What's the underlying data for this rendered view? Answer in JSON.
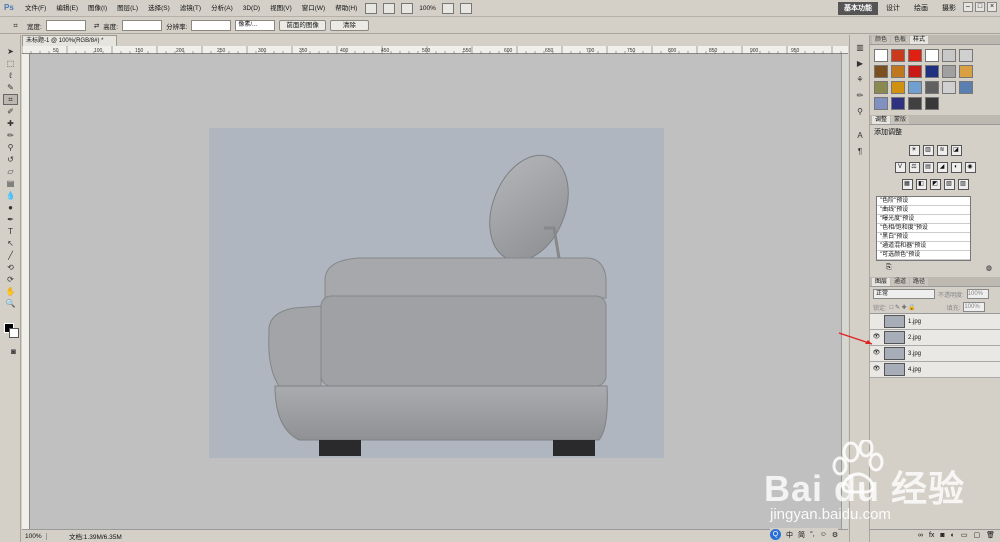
{
  "menubar": {
    "logo": "Ps",
    "items": [
      "文件(F)",
      "编辑(E)",
      "图像(I)",
      "图层(L)",
      "选择(S)",
      "滤镜(T)",
      "分析(A)",
      "3D(D)",
      "视图(V)",
      "窗口(W)",
      "帮助(H)"
    ],
    "zoom": "100%",
    "workspaces": [
      "基本功能",
      "设计",
      "绘画",
      "摄影"
    ],
    "window_buttons": [
      "–",
      "□",
      "×"
    ]
  },
  "options": {
    "width_label": "宽度:",
    "height_label": "高度:",
    "resolution_label": "分辨率:",
    "unit": "像素/...",
    "front_image_button": "前面的图像",
    "clear_button": "清除"
  },
  "document": {
    "tab_title": "未标题-1 @ 100%(RGB/8#) *",
    "zoom": "100%",
    "doc_info": "文档:1.39M/6.35M",
    "ruler_labels": [
      "50",
      "100",
      "150",
      "200",
      "250",
      "300",
      "350",
      "400",
      "450",
      "500",
      "550",
      "600",
      "650",
      "700",
      "750",
      "800",
      "850",
      "900",
      "950"
    ]
  },
  "panels": {
    "styles_tabs": [
      "颜色",
      "色板",
      "样式"
    ],
    "style_colors": [
      "#ffffff",
      "#c83a1a",
      "#e02010",
      "#ffffff",
      "#c8c8c8",
      "#d0d0d0",
      "#7a5020",
      "#c07820",
      "#c81818",
      "#203080",
      "#a0a0a0",
      "#d8a040",
      "#8a8a50",
      "#d09010",
      "#70a0d0",
      "#606060",
      "#d0d0d0",
      "#5a7fb0",
      "#8090c0",
      "#303080",
      "#404040",
      "#383838"
    ],
    "adjust_tabs": [
      "调整",
      "蒙版"
    ],
    "adjust_title": "添加调整",
    "adjust_icons_row1": [
      "☀",
      "▥",
      "≋",
      "◪"
    ],
    "adjust_icons_row2": [
      "V",
      "⚖",
      "▤",
      "◢",
      "◐",
      "◉"
    ],
    "adjust_icons_row3": [
      "▦",
      "◧",
      "◩",
      "▧",
      "▨"
    ],
    "presets": [
      "\"色阶\"预设",
      "\"曲线\"预设",
      "\"曝光度\"预设",
      "\"色相/饱和度\"预设",
      "\"黑白\"预设",
      "\"通道混和器\"预设",
      "\"可选颜色\"预设"
    ],
    "layers_tabs": [
      "图层",
      "通道",
      "路径"
    ],
    "blend_mode": "正常",
    "opacity_label": "不透明度:",
    "opacity_value": "100%",
    "lock_label": "锁定:",
    "fill_label": "填充:",
    "fill_value": "100%",
    "layers": [
      "1.jpg",
      "2.jpg",
      "3.jpg",
      "4.jpg"
    ]
  },
  "watermark": {
    "brand": "Bai du 经验",
    "url": "jingyan.baidu.com"
  },
  "ime_bar": {
    "labels": [
      "中",
      "简"
    ]
  }
}
